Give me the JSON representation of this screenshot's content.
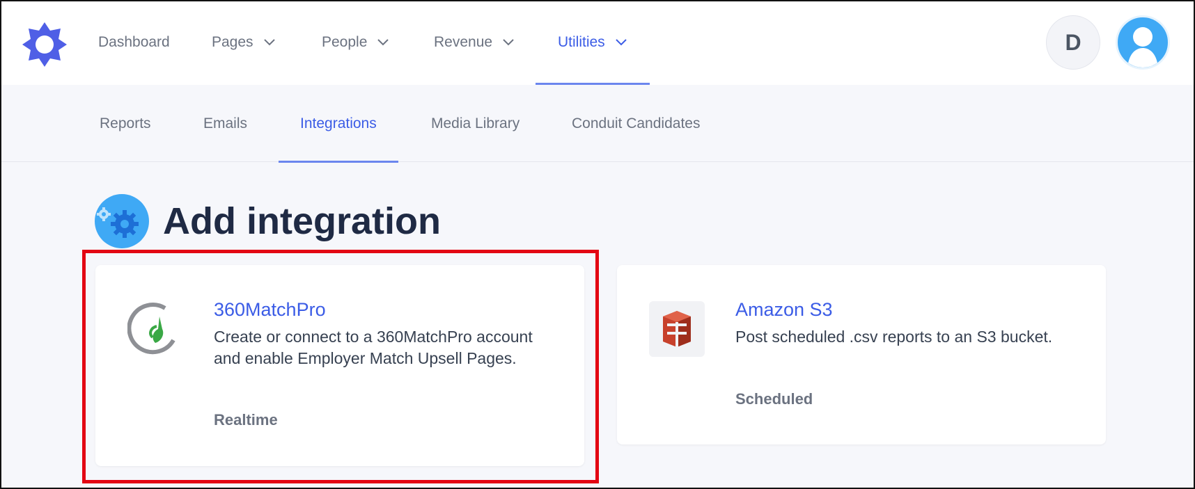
{
  "topnav": {
    "items": [
      {
        "label": "Dashboard"
      },
      {
        "label": "Pages"
      },
      {
        "label": "People"
      },
      {
        "label": "Revenue"
      },
      {
        "label": "Utilities"
      }
    ],
    "active": "Utilities",
    "account_initial": "D"
  },
  "subnav": {
    "items": [
      {
        "label": "Reports"
      },
      {
        "label": "Emails"
      },
      {
        "label": "Integrations"
      },
      {
        "label": "Media Library"
      },
      {
        "label": "Conduit Candidates"
      }
    ],
    "active": "Integrations"
  },
  "page": {
    "title": "Add integration",
    "icon": "gears-icon"
  },
  "integrations": [
    {
      "name": "360MatchPro",
      "description": "Create or connect to a 360MatchPro account and enable Employer Match Upsell Pages.",
      "type": "Realtime",
      "icon": "360matchpro-logo"
    },
    {
      "name": "Amazon S3",
      "description": "Post scheduled .csv reports to an S3 bucket.",
      "type": "Scheduled",
      "icon": "amazon-s3-logo"
    }
  ],
  "colors": {
    "accent": "#3b5ce6",
    "highlight": "#e30613",
    "brand_logo": "#4f5fe6"
  }
}
